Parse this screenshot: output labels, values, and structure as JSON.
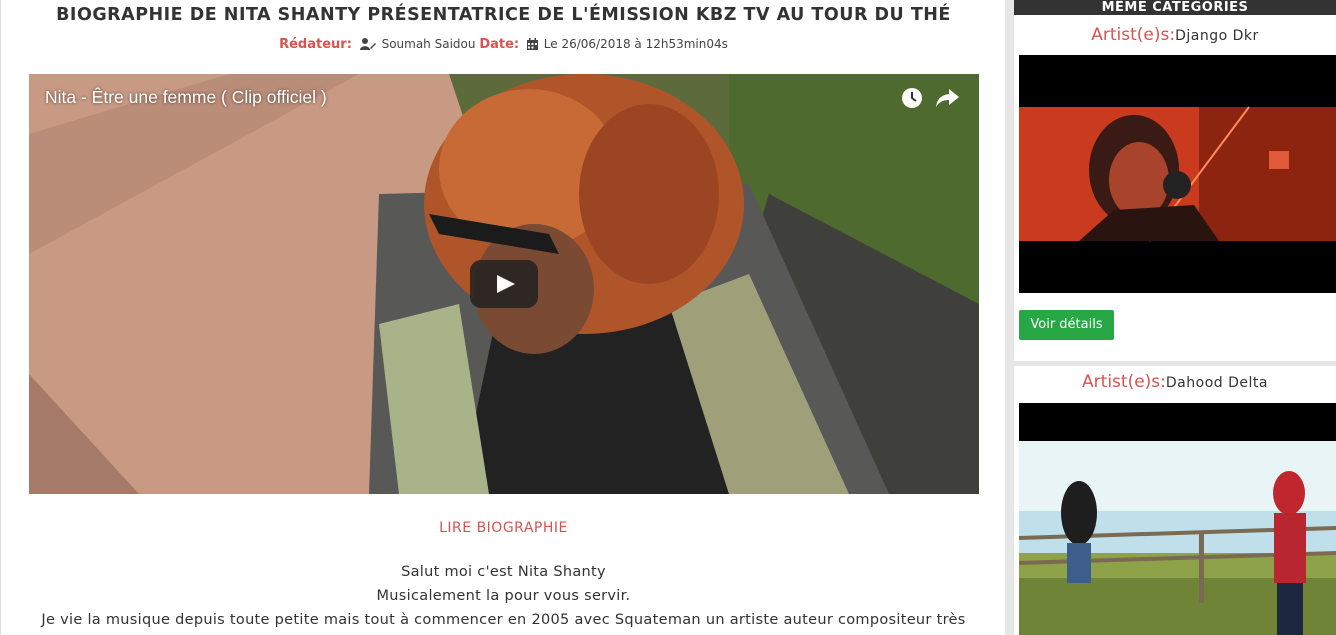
{
  "article": {
    "title": "BIOGRAPHIE DE NITA SHANTY PRÉSENTATRICE DE L'ÉMISSION KBZ TV AU TOUR DU THÉ",
    "author_label": "Rédateur:",
    "author": "Soumah Saidou",
    "date_label": "Date:",
    "date": "Le 26/06/2018 à 12h53min04s"
  },
  "video": {
    "title": "Nita - Être une femme ( Clip officiel )",
    "icons": [
      "clock-icon",
      "share-icon",
      "play-icon"
    ]
  },
  "read_bio_label": "LIRE BIOGRAPHIE",
  "bio_lines": [
    "Salut moi c'est Nita Shanty",
    "Musicalement la pour vous servir.",
    "Je vie la musique depuis toute petite mais tout à commencer en 2005 avec Squateman un artiste auteur compositeur très"
  ],
  "sidebar": {
    "header": "MÊME CATEGORIES",
    "cards": [
      {
        "artist_label": "Artist(e)s:",
        "artist": "Django Dkr",
        "button": "Voir détails"
      },
      {
        "artist_label": "Artist(e)s:",
        "artist": "Dahood Delta"
      }
    ]
  },
  "colors": {
    "accent_red": "#d9534f",
    "button_green": "#28a745",
    "header_dark": "#333333"
  }
}
